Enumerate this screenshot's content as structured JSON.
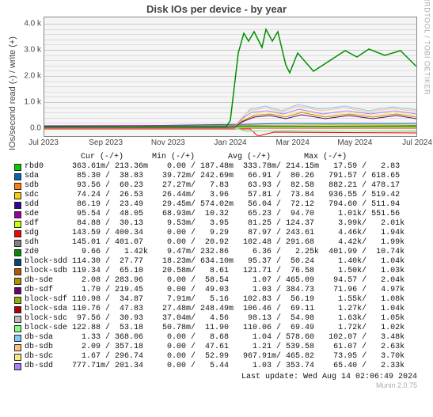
{
  "title": "Disk IOs per device - by year",
  "ylabel": "IOs/second read (-) / write (+)",
  "watermark": "RRDTOOL / TOBI OETIKER",
  "munin_version": "Munin 2.0.75",
  "last_update": "Last update: Wed Aug 14 02:06:49 2024",
  "legend_header": "              Cur (-/+)      Min (-/+)       Avg (-/+)       Max (-/+)",
  "chart_data": {
    "type": "line",
    "title": "Disk IOs per device - by year",
    "xlabel": "",
    "ylabel": "IOs/second read (-) / write (+)",
    "x_ticks": [
      "Jul 2023",
      "Sep 2023",
      "Nov 2023",
      "Jan 2024",
      "Mar 2024",
      "May 2024",
      "Jul 2024"
    ],
    "y_ticks": [
      "0.0",
      "1.0 k",
      "2.0 k",
      "3.0 k",
      "4.0 k"
    ],
    "ylim": [
      -200,
      4200
    ],
    "note": "Many overlapping low-amplitude series near 0; one series (sdh) rises sharply around Feb 2024 to ~3.0–3.8k, drops to ~2.2k around Apr 2024, and holds ~2.4–3.0k through Aug 2024. Block-* and db-* series form a band roughly 300–800 from Feb 2024 onward."
  },
  "series": [
    {
      "name": "rbd0",
      "color": "#00cc00",
      "cur": "363.61m/ 213.36m",
      "min": "  0.00 / 187.48m",
      "avg": "333.78m/ 214.15m",
      "max": " 17.59 /   2.83"
    },
    {
      "name": "sda",
      "color": "#0066b3",
      "cur": " 85.30 /  38.83",
      "min": " 39.72m/ 242.69m",
      "avg": " 66.91 /  80.26",
      "max": "791.57 / 618.65"
    },
    {
      "name": "sdb",
      "color": "#ff8000",
      "cur": " 93.56 /  60.23",
      "min": " 27.27m/   7.83",
      "avg": " 63.93 /  82.58",
      "max": "882.21 / 478.17"
    },
    {
      "name": "sdc",
      "color": "#ffcc00",
      "cur": " 74.24 /  26.53",
      "min": " 26.44m/   3.96",
      "avg": " 57.81 /  73.84",
      "max": "936.55 / 519.42"
    },
    {
      "name": "sdd",
      "color": "#330099",
      "cur": " 86.19 /  23.49",
      "min": " 29.45m/ 574.02m",
      "avg": " 56.04 /  72.12",
      "max": "794.60 / 511.94"
    },
    {
      "name": "sde",
      "color": "#990099",
      "cur": " 95.54 /  48.05",
      "min": " 68.93m/  10.32",
      "avg": " 65.23 /  94.70",
      "max": "  1.01k/ 551.56"
    },
    {
      "name": "sdf",
      "color": "#ccff00",
      "cur": " 84.88 /  30.13",
      "min": "  9.53m/   3.95",
      "avg": " 81.25 / 124.37",
      "max": "  3.99k/   2.01k"
    },
    {
      "name": "sdg",
      "color": "#ff0000",
      "cur": "143.59 / 400.34",
      "min": "  0.00 /   9.29",
      "avg": " 87.97 / 243.61",
      "max": "  4.46k/   1.94k"
    },
    {
      "name": "sdh",
      "color": "#808080",
      "cur": "145.01 / 401.07",
      "min": "  0.00 /  20.92",
      "avg": "102.48 / 291.68",
      "max": "  4.42k/   1.99k"
    },
    {
      "name": "zd0",
      "color": "#008f00",
      "cur": "  9.66 /   1.42k",
      "min": "  9.47m/ 232.86",
      "avg": "  6.36 /   2.25k",
      "max": "401.99 /  10.74k"
    },
    {
      "name": "block-sdd",
      "color": "#00487d",
      "cur": "114.30 /  27.77",
      "min": " 18.23m/ 634.10m",
      "avg": " 95.37 /  50.24",
      "max": "  1.40k/   1.04k"
    },
    {
      "name": "block-sdb",
      "color": "#b35a00",
      "cur": "119.34 /  65.10",
      "min": " 20.58m/   8.61",
      "avg": "121.71 /  76.58",
      "max": "  1.50k/   1.03k"
    },
    {
      "name": "db-sde",
      "color": "#b38f00",
      "cur": "  2.08 / 283.96",
      "min": "  0.00 /  58.54",
      "avg": "  1.07 / 465.09",
      "max": " 94.57 /   2.04k"
    },
    {
      "name": "db-sdf",
      "color": "#6b006b",
      "cur": "  1.70 / 219.45",
      "min": "  0.00 /  49.03",
      "avg": "  1.03 / 384.73",
      "max": " 71.96 /   4.97k"
    },
    {
      "name": "block-sdf",
      "color": "#8fb300",
      "cur": "110.98 /  34.87",
      "min": "  7.91m/   5.16",
      "avg": "102.83 /  56.19",
      "max": "  1.55k/   1.08k"
    },
    {
      "name": "block-sda",
      "color": "#b30000",
      "cur": "110.76 /  47.83",
      "min": " 27.48m/ 248.49m",
      "avg": "106.46 /  69.11",
      "max": "  1.27k/   1.04k"
    },
    {
      "name": "block-sdc",
      "color": "#bebebe",
      "cur": " 97.56 /  30.93",
      "min": " 37.04m/   4.56",
      "avg": " 98.13 /  54.98",
      "max": "  1.63k/   1.05k"
    },
    {
      "name": "block-sde",
      "color": "#80ff80",
      "cur": "122.88 /  53.18",
      "min": " 50.78m/  11.90",
      "avg": "110.06 /  69.49",
      "max": "  1.72k/   1.02k"
    },
    {
      "name": "db-sda",
      "color": "#80c9ff",
      "cur": "  1.33 / 368.06",
      "min": "  0.00 /   8.68",
      "avg": "  1.04 / 578.60",
      "max": "102.07 /   3.48k"
    },
    {
      "name": "db-sdb",
      "color": "#ffc080",
      "cur": "  2.09 / 357.18",
      "min": "  0.00 /  47.61",
      "avg": "  1.21 / 539.58",
      "max": " 61.07 /   2.63k"
    },
    {
      "name": "db-sdc",
      "color": "#ffe680",
      "cur": "  1.67 / 296.74",
      "min": "  0.00 /  52.99",
      "avg": "967.91m/ 465.82",
      "max": " 73.95 /   3.70k"
    },
    {
      "name": "db-sdd",
      "color": "#aa80ff",
      "cur": "777.71m/ 201.34",
      "min": "  0.00 /   5.44",
      "avg": "  1.03 / 353.74",
      "max": " 65.40 /   2.33k"
    }
  ]
}
